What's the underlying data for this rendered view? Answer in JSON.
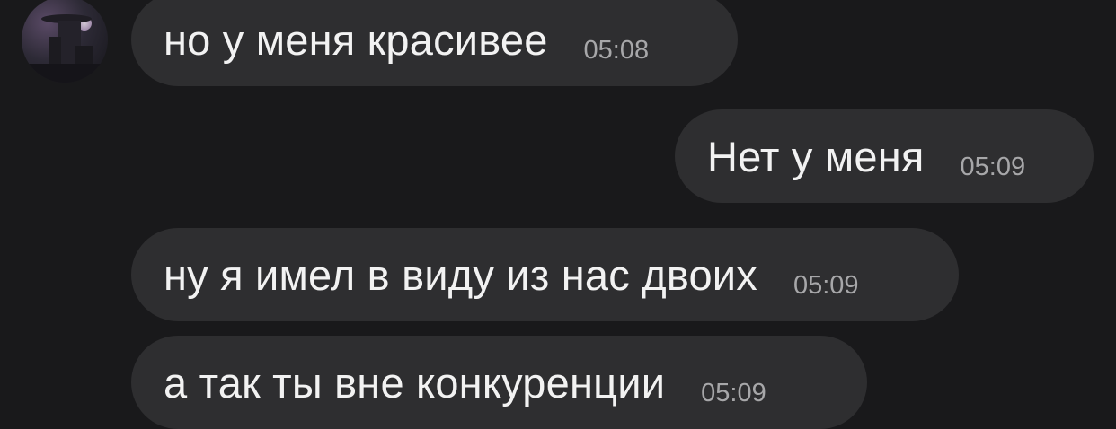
{
  "chat": {
    "contact": {
      "avatar_icon": "profile-photo"
    },
    "messages": [
      {
        "direction": "incoming",
        "text": "но у меня красивее",
        "time": "05:08"
      },
      {
        "direction": "outgoing",
        "text": "Нет у меня",
        "time": "05:09"
      },
      {
        "direction": "incoming",
        "text": "ну я имел в виду из нас двоих",
        "time": "05:09"
      },
      {
        "direction": "incoming",
        "text": "а так ты вне конкуренции",
        "time": "05:09"
      }
    ]
  },
  "colors": {
    "background": "#19191b",
    "bubble": "#2e2e30",
    "text": "#f2f2f2",
    "time": "#a7a7a9"
  }
}
